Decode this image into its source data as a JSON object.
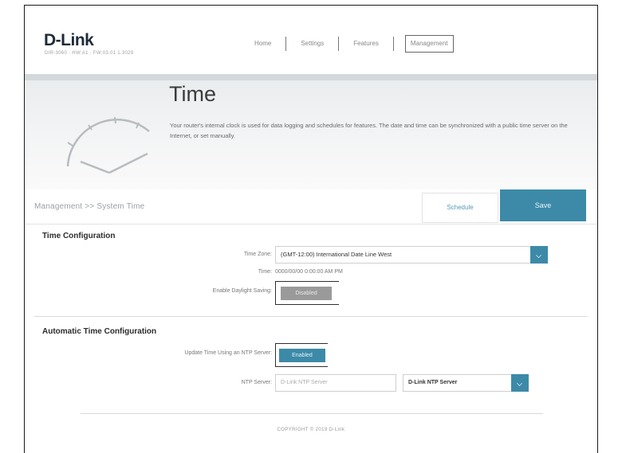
{
  "header": {
    "logo": "D-Link",
    "logo_sub": "DIR-3060 · HW:A1 · FW:03.01 1.3029"
  },
  "nav": {
    "items": [
      "Home",
      "Settings",
      "Features",
      "Management"
    ],
    "active": "Management"
  },
  "hero": {
    "title": "Time",
    "description": "Your router's internal clock is used for data logging and schedules for features. The date and time can be synchronized with a public time server on the Internet, or set manually."
  },
  "breadcrumb": "Management >> System Time",
  "buttons": {
    "schedule": "Schedule",
    "save": "Save"
  },
  "time_config": {
    "title": "Time Configuration",
    "timezone_label": "Time Zone:",
    "timezone_value": "(GMT-12:00) International Date Line West",
    "time_label": "Time:",
    "time_value": "0000/00/00 0:00:00 AM PM",
    "dst_label": "Enable Daylight Saving:",
    "dst_value": "Disabled"
  },
  "auto_time": {
    "title": "Automatic Time Configuration",
    "ntp_toggle_label": "Update Time Using an NTP Server:",
    "ntp_toggle_value": "Enabled",
    "ntp_server_label": "NTP Server:",
    "ntp_server_placeholder": "D-Link NTP Server",
    "ntp_server_select": "D-Link NTP Server"
  },
  "footer": "COPYRIGHT © 2019 D-Link",
  "colors": {
    "accent": "#3c8aa8",
    "toggle_disabled": "#9a9a9a"
  }
}
